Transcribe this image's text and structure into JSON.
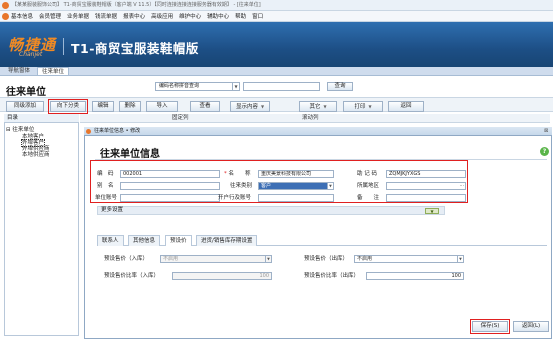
{
  "window": {
    "title": "【某某服装服饰公司】 T1-商贸宝服装鞋帽版（客户端 V 11.5）【同时连接连接连接服务器有效期】 - [往来单位]"
  },
  "menu": [
    "基本信息",
    "会员管理",
    "业务单据",
    "钱流单据",
    "报表中心",
    "高级应用",
    "维护中心",
    "辅助中心",
    "帮助",
    "窗口"
  ],
  "brand": {
    "logo": "畅捷通",
    "logo_sub": "Chanjet",
    "product": "T1-商贸宝服装鞋帽版",
    "accent_color": "#f08a24"
  },
  "tabs": [
    "导航窗体",
    "往来单位"
  ],
  "page": {
    "title": "往来单位",
    "search_field": "编码名称拼音查询",
    "search_value": "",
    "query_label": "查询"
  },
  "toolbar": [
    "同级添加",
    "向下分类",
    "编辑",
    "删除",
    "导入",
    "查看",
    "显示内容",
    "其它",
    "打印",
    "返回"
  ],
  "tree": {
    "header": "目录",
    "root": "往来单位",
    "children": [
      "本地客户",
      "外埠客户",
      "外埠供应商",
      "本地供应商"
    ]
  },
  "columns": [
    "固定列",
    "滚动列"
  ],
  "dialog": {
    "title": "往来单位信息 • 修改",
    "heading": "往来单位信息",
    "close": "⊠",
    "fields": {
      "code_label": "编　码",
      "code_value": "002001",
      "name_label": "名　　称",
      "name_value": "重庆美景科技有限公司",
      "mnemonic_label": "助 记 码",
      "mnemonic_value": "ZQMJKJYXGS",
      "alias_label": "别　名",
      "alias_value": "",
      "type_label": "往来类别",
      "type_value": "客户",
      "region_label": "所属地区",
      "region_value": "",
      "account_label": "单位账号",
      "account_value": "",
      "bank_label": "开户行及账号",
      "bank_value": "",
      "remark_label": "备　　注",
      "remark_value": ""
    },
    "more_settings": "更多设置",
    "subtabs": [
      "联系人",
      "其他信息",
      "预设价",
      "进货/销售库存期设置"
    ],
    "active_subtab": 2,
    "price": {
      "in_label": "预设售价（入库）",
      "in_value": "不启用",
      "out_label": "预设售价（出库）",
      "out_value": "不启用",
      "in_ratio_label": "预设售价比率（入库）",
      "in_ratio_value": "100",
      "out_ratio_label": "预设售价比率（出库）",
      "out_ratio_value": "100"
    },
    "save_label": "保存(S)",
    "back_label": "返回(L)"
  }
}
